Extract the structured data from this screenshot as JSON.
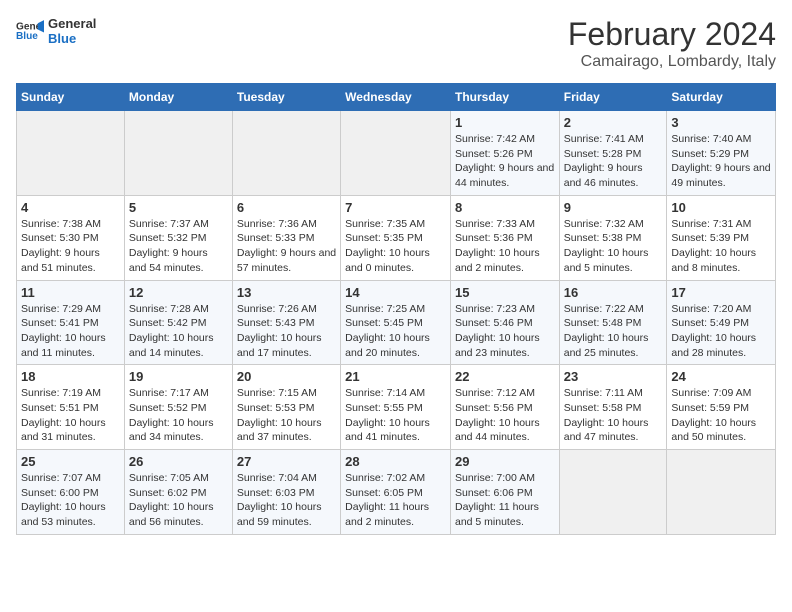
{
  "logo": {
    "text_general": "General",
    "text_blue": "Blue"
  },
  "title": "February 2024",
  "subtitle": "Camairago, Lombardy, Italy",
  "weekdays": [
    "Sunday",
    "Monday",
    "Tuesday",
    "Wednesday",
    "Thursday",
    "Friday",
    "Saturday"
  ],
  "weeks": [
    [
      {
        "day": "",
        "info": ""
      },
      {
        "day": "",
        "info": ""
      },
      {
        "day": "",
        "info": ""
      },
      {
        "day": "",
        "info": ""
      },
      {
        "day": "1",
        "info": "Sunrise: 7:42 AM\nSunset: 5:26 PM\nDaylight: 9 hours and 44 minutes."
      },
      {
        "day": "2",
        "info": "Sunrise: 7:41 AM\nSunset: 5:28 PM\nDaylight: 9 hours and 46 minutes."
      },
      {
        "day": "3",
        "info": "Sunrise: 7:40 AM\nSunset: 5:29 PM\nDaylight: 9 hours and 49 minutes."
      }
    ],
    [
      {
        "day": "4",
        "info": "Sunrise: 7:38 AM\nSunset: 5:30 PM\nDaylight: 9 hours and 51 minutes."
      },
      {
        "day": "5",
        "info": "Sunrise: 7:37 AM\nSunset: 5:32 PM\nDaylight: 9 hours and 54 minutes."
      },
      {
        "day": "6",
        "info": "Sunrise: 7:36 AM\nSunset: 5:33 PM\nDaylight: 9 hours and 57 minutes."
      },
      {
        "day": "7",
        "info": "Sunrise: 7:35 AM\nSunset: 5:35 PM\nDaylight: 10 hours and 0 minutes."
      },
      {
        "day": "8",
        "info": "Sunrise: 7:33 AM\nSunset: 5:36 PM\nDaylight: 10 hours and 2 minutes."
      },
      {
        "day": "9",
        "info": "Sunrise: 7:32 AM\nSunset: 5:38 PM\nDaylight: 10 hours and 5 minutes."
      },
      {
        "day": "10",
        "info": "Sunrise: 7:31 AM\nSunset: 5:39 PM\nDaylight: 10 hours and 8 minutes."
      }
    ],
    [
      {
        "day": "11",
        "info": "Sunrise: 7:29 AM\nSunset: 5:41 PM\nDaylight: 10 hours and 11 minutes."
      },
      {
        "day": "12",
        "info": "Sunrise: 7:28 AM\nSunset: 5:42 PM\nDaylight: 10 hours and 14 minutes."
      },
      {
        "day": "13",
        "info": "Sunrise: 7:26 AM\nSunset: 5:43 PM\nDaylight: 10 hours and 17 minutes."
      },
      {
        "day": "14",
        "info": "Sunrise: 7:25 AM\nSunset: 5:45 PM\nDaylight: 10 hours and 20 minutes."
      },
      {
        "day": "15",
        "info": "Sunrise: 7:23 AM\nSunset: 5:46 PM\nDaylight: 10 hours and 23 minutes."
      },
      {
        "day": "16",
        "info": "Sunrise: 7:22 AM\nSunset: 5:48 PM\nDaylight: 10 hours and 25 minutes."
      },
      {
        "day": "17",
        "info": "Sunrise: 7:20 AM\nSunset: 5:49 PM\nDaylight: 10 hours and 28 minutes."
      }
    ],
    [
      {
        "day": "18",
        "info": "Sunrise: 7:19 AM\nSunset: 5:51 PM\nDaylight: 10 hours and 31 minutes."
      },
      {
        "day": "19",
        "info": "Sunrise: 7:17 AM\nSunset: 5:52 PM\nDaylight: 10 hours and 34 minutes."
      },
      {
        "day": "20",
        "info": "Sunrise: 7:15 AM\nSunset: 5:53 PM\nDaylight: 10 hours and 37 minutes."
      },
      {
        "day": "21",
        "info": "Sunrise: 7:14 AM\nSunset: 5:55 PM\nDaylight: 10 hours and 41 minutes."
      },
      {
        "day": "22",
        "info": "Sunrise: 7:12 AM\nSunset: 5:56 PM\nDaylight: 10 hours and 44 minutes."
      },
      {
        "day": "23",
        "info": "Sunrise: 7:11 AM\nSunset: 5:58 PM\nDaylight: 10 hours and 47 minutes."
      },
      {
        "day": "24",
        "info": "Sunrise: 7:09 AM\nSunset: 5:59 PM\nDaylight: 10 hours and 50 minutes."
      }
    ],
    [
      {
        "day": "25",
        "info": "Sunrise: 7:07 AM\nSunset: 6:00 PM\nDaylight: 10 hours and 53 minutes."
      },
      {
        "day": "26",
        "info": "Sunrise: 7:05 AM\nSunset: 6:02 PM\nDaylight: 10 hours and 56 minutes."
      },
      {
        "day": "27",
        "info": "Sunrise: 7:04 AM\nSunset: 6:03 PM\nDaylight: 10 hours and 59 minutes."
      },
      {
        "day": "28",
        "info": "Sunrise: 7:02 AM\nSunset: 6:05 PM\nDaylight: 11 hours and 2 minutes."
      },
      {
        "day": "29",
        "info": "Sunrise: 7:00 AM\nSunset: 6:06 PM\nDaylight: 11 hours and 5 minutes."
      },
      {
        "day": "",
        "info": ""
      },
      {
        "day": "",
        "info": ""
      }
    ]
  ]
}
